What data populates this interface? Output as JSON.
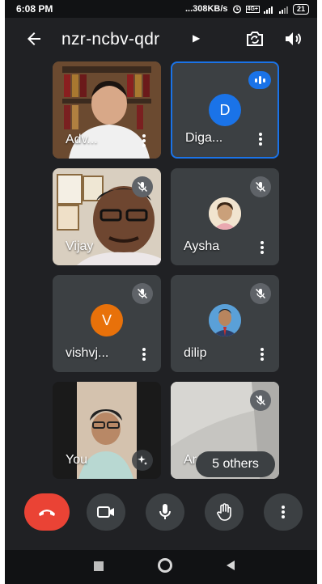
{
  "status_bar": {
    "time": "6:08 PM",
    "net_speed": "...308KB/s",
    "network_type": "4G+",
    "battery": "21"
  },
  "header": {
    "meeting_code": "nzr-ncbv-qdr"
  },
  "participants": [
    {
      "name": "Adv...",
      "avatar_type": "video"
    },
    {
      "name": "Diga...",
      "avatar_letter": "D",
      "avatar_color": "#1a73e8",
      "speaking": true
    },
    {
      "name": "Vijay",
      "avatar_type": "video",
      "muted": true
    },
    {
      "name": "Aysha",
      "avatar_type": "photo",
      "muted": true
    },
    {
      "name": "vishvj...",
      "avatar_letter": "V",
      "avatar_color": "#e8710a",
      "muted": true
    },
    {
      "name": "dilip",
      "avatar_type": "photo",
      "muted": true
    },
    {
      "name": "You",
      "avatar_type": "video"
    },
    {
      "name": "Ar",
      "avatar_type": "video",
      "muted": true
    }
  ],
  "others_label": "5 others",
  "colors": {
    "end_call": "#ea4335",
    "accent": "#1a73e8",
    "background": "#202124",
    "control_bg": "#3c4043"
  },
  "controls": [
    "end-call-icon",
    "camera-icon",
    "microphone-icon",
    "raise-hand-icon",
    "more-options-icon"
  ]
}
